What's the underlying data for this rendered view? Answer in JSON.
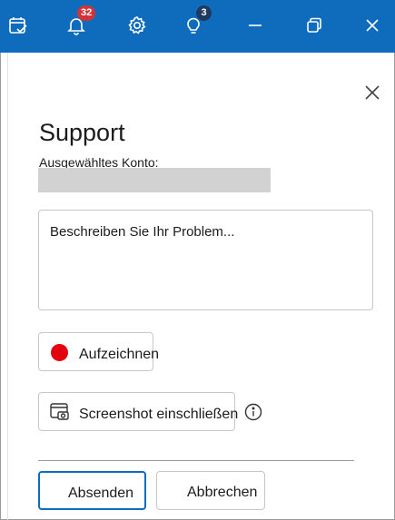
{
  "titlebar": {
    "notifications_count": "32",
    "tips_count": "3",
    "bg_color": "#0f6cbd"
  },
  "icons": {
    "calendar": "calendar-check-icon",
    "bell": "bell-icon",
    "settings": "gear-icon",
    "tips": "lightbulb-icon",
    "minimize": "minimize-icon",
    "restore": "restore-icon",
    "close": "close-icon",
    "record": "record-dot-icon",
    "screenshot": "screenshot-icon",
    "info": "info-icon"
  },
  "panel": {
    "title": "Support",
    "account_label": "Ausgewähltes Konto:",
    "description_placeholder": "Beschreiben Sie Ihr Problem...",
    "record_label": "Aufzeichnen",
    "screenshot_label": "Screenshot einschließen",
    "send_label": "Absenden",
    "cancel_label": "Abbrechen"
  },
  "colors": {
    "accent": "#0f6cbd",
    "record": "#e3000f",
    "badge_red": "#d13438"
  }
}
